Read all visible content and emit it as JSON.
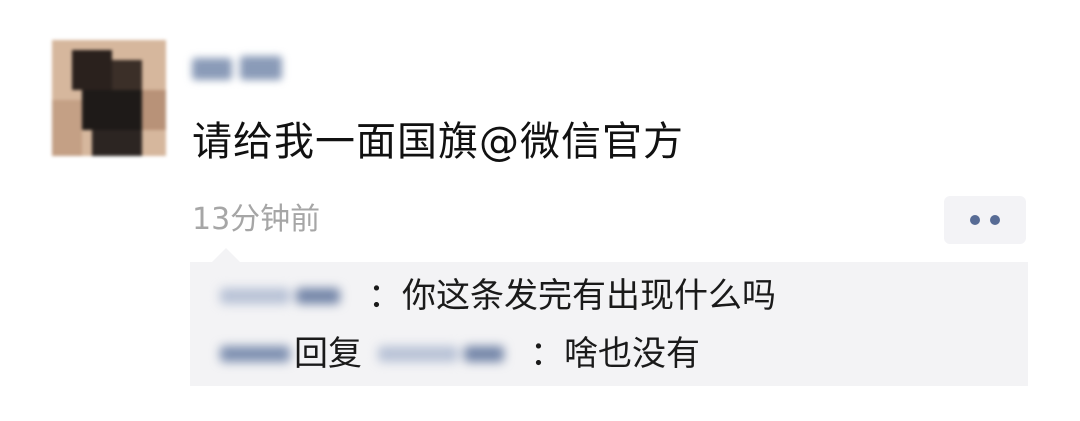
{
  "post": {
    "text": "请给我一面国旗@微信官方",
    "timestamp": "13分钟前",
    "more_icon": "more-dots-icon"
  },
  "comments": [
    {
      "colon_text": "：你这条发完有出现什么吗"
    },
    {
      "reply_label": "回复",
      "colon_text": "：啥也没有"
    }
  ],
  "colors": {
    "link_blue": "#576b95",
    "timestamp_gray": "#a6a6a6",
    "comment_bg": "#f3f3f5"
  }
}
